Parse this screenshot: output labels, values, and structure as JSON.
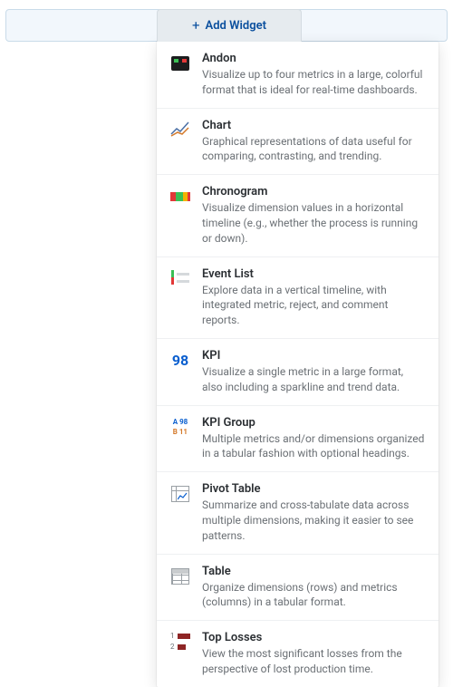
{
  "header": {
    "add_widget_label": "Add Widget"
  },
  "widgets": [
    {
      "id": "andon",
      "title": "Andon",
      "desc": "Visualize up to four metrics in a large, colorful format that is ideal for real-time dashboards."
    },
    {
      "id": "chart",
      "title": "Chart",
      "desc": "Graphical representations of data useful for comparing, contrasting, and trending."
    },
    {
      "id": "chronogram",
      "title": "Chronogram",
      "desc": "Visualize dimension values in a horizontal timeline (e.g., whether the process is running or down)."
    },
    {
      "id": "event-list",
      "title": "Event List",
      "desc": "Explore data in a vertical timeline, with integrated metric, reject, and comment reports."
    },
    {
      "id": "kpi",
      "title": "KPI",
      "desc": "Visualize a single metric in a large format, also including a sparkline and trend data.",
      "sample": "98"
    },
    {
      "id": "kpi-group",
      "title": "KPI Group",
      "desc": "Multiple metrics and/or dimensions organized in a tabular fashion with optional headings.",
      "sample_a": "A 98",
      "sample_b": "B 11"
    },
    {
      "id": "pivot-table",
      "title": "Pivot Table",
      "desc": "Summarize and cross-tabulate data across multiple dimensions, making it easier to see patterns."
    },
    {
      "id": "table",
      "title": "Table",
      "desc": "Organize dimensions (rows) and metrics (columns) in a tabular format."
    },
    {
      "id": "top-losses",
      "title": "Top Losses",
      "desc": "View the most significant losses from the perspective of lost production time.",
      "rank1": "1",
      "rank2": "2"
    }
  ]
}
